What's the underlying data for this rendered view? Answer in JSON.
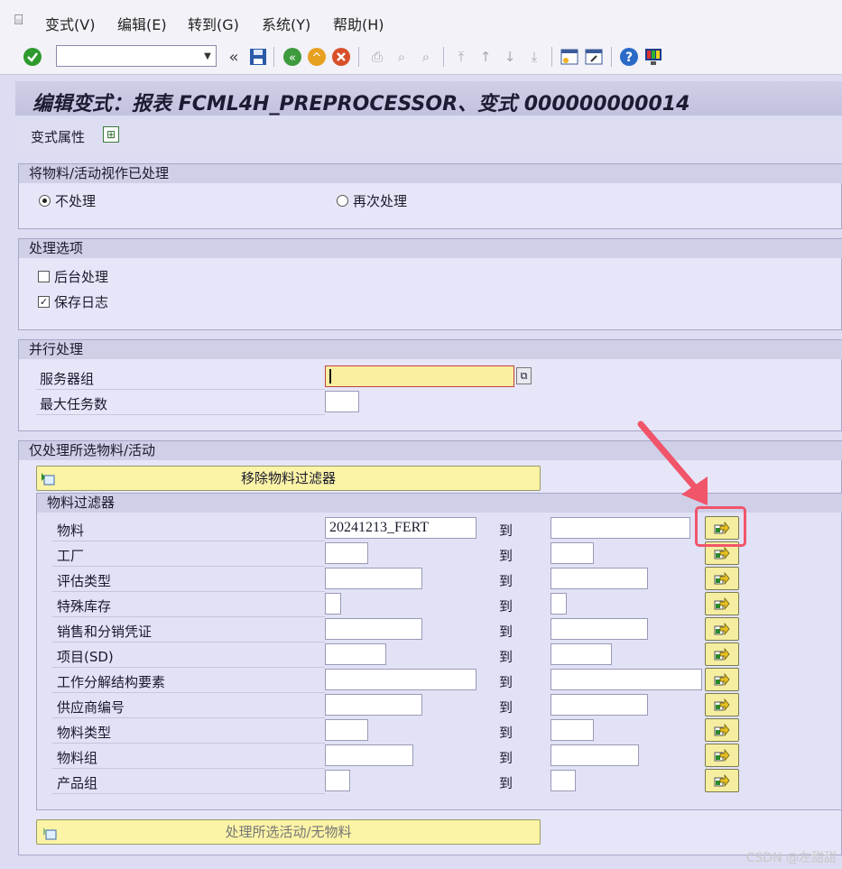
{
  "menu": {
    "items": [
      "变式(V)",
      "编辑(E)",
      "转到(G)",
      "系统(Y)",
      "帮助(H)"
    ]
  },
  "toolbar": {
    "command_value": "",
    "icons": [
      "enter-icon",
      "back-double-icon",
      "save-icon",
      "back-icon",
      "exit-icon",
      "cancel-icon",
      "print-icon",
      "find-icon",
      "find-next-icon",
      "first-page-icon",
      "prev-page-icon",
      "next-page-icon",
      "last-page-icon",
      "new-session-icon",
      "shortcut-icon",
      "help-icon",
      "settings-icon"
    ]
  },
  "title": "编辑变式：报表 FCML4H_PREPROCESSOR、变式 000000000014",
  "appbar": {
    "variant_attributes": "变式属性"
  },
  "section_processed": {
    "title": "将物料/活动视作已处理",
    "options": [
      {
        "label": "不处理",
        "selected": true
      },
      {
        "label": "再次处理",
        "selected": false
      }
    ]
  },
  "section_options": {
    "title": "处理选项",
    "checks": [
      {
        "label": "后台处理",
        "checked": false
      },
      {
        "label": "保存日志",
        "checked": true
      }
    ]
  },
  "section_parallel": {
    "title": "并行处理",
    "server_group_label": "服务器组",
    "server_group_value": "",
    "max_tasks_label": "最大任务数",
    "max_tasks_value": ""
  },
  "section_selected": {
    "title": "仅处理所选物料/活动",
    "remove_filter_button": "移除物料过滤器",
    "filter_title": "物料过滤器",
    "to_label": "到",
    "rows": [
      {
        "label": "物料",
        "from": "20241213_FERT",
        "to": ""
      },
      {
        "label": "工厂",
        "from": "",
        "to": ""
      },
      {
        "label": "评估类型",
        "from": "",
        "to": ""
      },
      {
        "label": "特殊库存",
        "from": "",
        "to": ""
      },
      {
        "label": "销售和分销凭证",
        "from": "",
        "to": ""
      },
      {
        "label": "项目(SD)",
        "from": "",
        "to": ""
      },
      {
        "label": "工作分解结构要素",
        "from": "",
        "to": ""
      },
      {
        "label": "供应商编号",
        "from": "",
        "to": ""
      },
      {
        "label": "物料类型",
        "from": "",
        "to": ""
      },
      {
        "label": "物料组",
        "from": "",
        "to": ""
      },
      {
        "label": "产品组",
        "from": "",
        "to": ""
      }
    ],
    "process_button": "处理所选活动/无物料"
  },
  "watermark": "CSDN @左甜甜"
}
